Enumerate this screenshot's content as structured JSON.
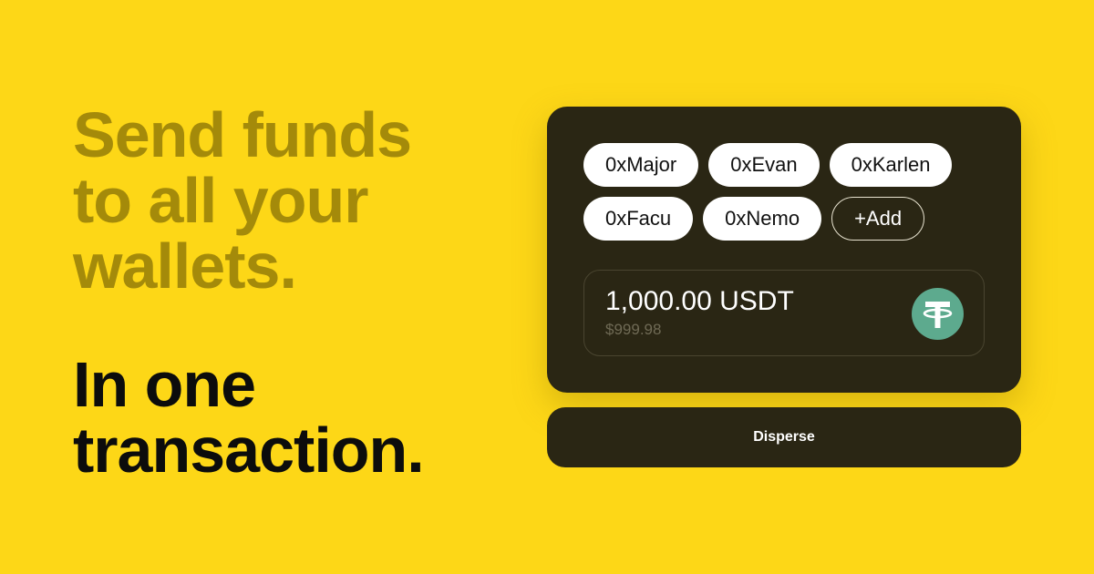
{
  "headline": {
    "lines": [
      "Send funds",
      "to all your",
      "wallets."
    ]
  },
  "subline": {
    "lines": [
      "In one",
      "transaction."
    ]
  },
  "wallets": [
    "0xMajor",
    "0xEvan",
    "0xKarlen",
    "0xFacu",
    "0xNemo"
  ],
  "add_label": "+Add",
  "amount": {
    "value": "1,000.00 USDT",
    "fiat": "$999.98",
    "token_icon": "tether-icon"
  },
  "disperse_label": "Disperse",
  "colors": {
    "background": "#FDD717",
    "headline": "#A48A0A",
    "card": "#2A2614",
    "tether": "#5DAA8E"
  }
}
